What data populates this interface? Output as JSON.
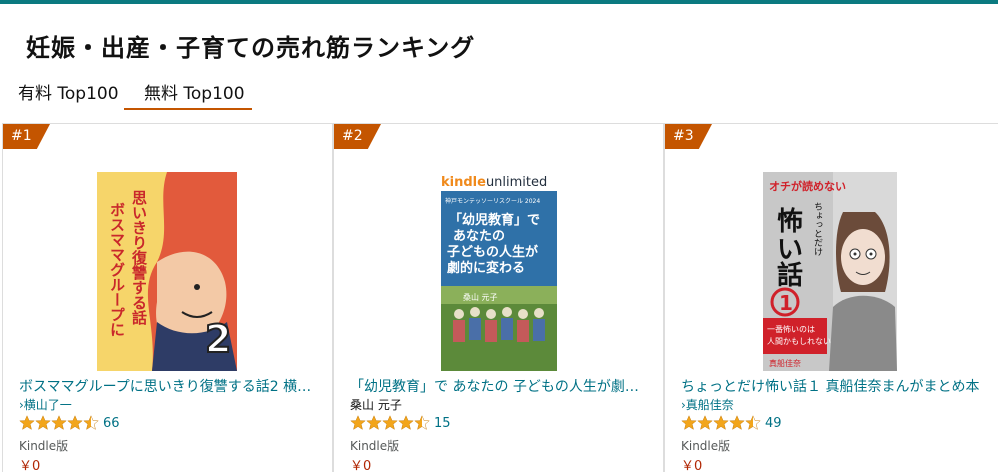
{
  "page": {
    "title": "妊娠・出産・子育ての売れ筋ランキング"
  },
  "tabs": [
    {
      "label": "有料 Top100",
      "active": false
    },
    {
      "label": "無料 Top100",
      "active": true
    }
  ],
  "colors": {
    "accent": "#c45500",
    "link": "#007185",
    "price": "#b12704",
    "star": "#f2a51b",
    "top_bar": "#0b7a80"
  },
  "items": [
    {
      "rank": "#1",
      "cover_text": [
        "ボスママグループに",
        "思いきり復讐する話"
      ],
      "cover_number": "2",
      "title": "ボスママグループに思いきり復讐する話2 横…",
      "author": "›横山了一",
      "rating": 4.5,
      "reviews": "66",
      "format": "Kindle版",
      "price": "￥0"
    },
    {
      "rank": "#2",
      "cover_brand": "kindleunlimited",
      "cover_brand_a": "kindle",
      "cover_brand_b": "unlimited",
      "cover_school": "神戸モンテッソーリスクール 2024",
      "cover_lines": [
        "「幼児教育」で",
        "あなたの",
        "子どもの人生が",
        "劇的に変わる"
      ],
      "cover_author": "桑山 元子",
      "title": "「幼児教育」で あなたの 子どもの人生が劇…",
      "author": "桑山 元子",
      "rating": 4.5,
      "reviews": "15",
      "format": "Kindle版",
      "price": "￥0"
    },
    {
      "rank": "#3",
      "cover_top": "オチが読めない",
      "cover_side": "ちょっとだけ",
      "cover_big1": "怖",
      "cover_big2": "い",
      "cover_big3": "話",
      "cover_number": "1",
      "cover_tag": [
        "一番怖いのは",
        "人間かもしれない"
      ],
      "cover_author": "真船佳奈",
      "title": "ちょっとだけ怖い話１ 真船佳奈まんがまとめ本",
      "author": "›真船佳奈",
      "rating": 4.5,
      "reviews": "49",
      "format": "Kindle版",
      "price": "￥0"
    }
  ]
}
